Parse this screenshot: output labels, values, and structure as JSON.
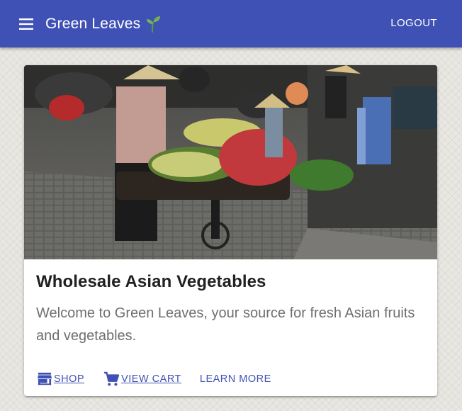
{
  "appbar": {
    "title": "Green Leaves",
    "menu_icon": "menu-icon",
    "brand_icon": "sprout-icon",
    "logout_label": "LOGOUT",
    "color": "#3f51b5"
  },
  "card": {
    "image_alt": "Street vendor with bicycle carrying fruit and vegetables",
    "title": "Wholesale Asian Vegetables",
    "description": "Welcome to Green Leaves, your source for fresh Asian fruits and vegetables.",
    "actions": [
      {
        "label": "SHOP",
        "icon": "store-icon"
      },
      {
        "label": "VIEW CART",
        "icon": "cart-icon"
      },
      {
        "label": "LEARN MORE"
      }
    ]
  }
}
